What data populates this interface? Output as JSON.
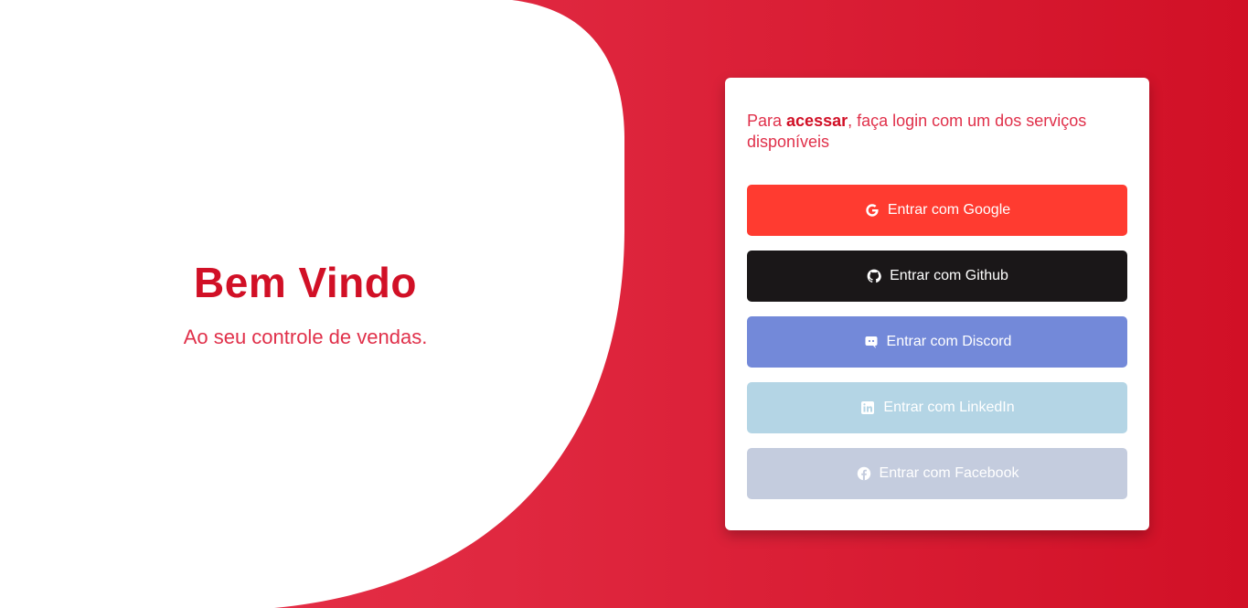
{
  "welcome": {
    "title": "Bem Vindo",
    "subtitle": "Ao seu controle de vendas."
  },
  "login_card": {
    "intro_prefix": "Para ",
    "intro_bold": "acessar",
    "intro_suffix": ", faça login com um dos serviços disponíveis",
    "buttons": [
      {
        "label": "Entrar com Google",
        "icon": "google-icon",
        "color": "#ff3b30"
      },
      {
        "label": "Entrar com Github",
        "icon": "github-icon",
        "color": "#1a1718"
      },
      {
        "label": "Entrar com Discord",
        "icon": "discord-icon",
        "color": "#7389d9"
      },
      {
        "label": "Entrar com LinkedIn",
        "icon": "linkedin-icon",
        "color": "#b4d5e5"
      },
      {
        "label": "Entrar com Facebook",
        "icon": "facebook-icon",
        "color": "#c4ccde"
      }
    ]
  },
  "colors": {
    "brand_red": "#d11026",
    "accent_red": "#e0304a",
    "background_gradient_start": "#e8334b",
    "background_gradient_end": "#d11026"
  }
}
